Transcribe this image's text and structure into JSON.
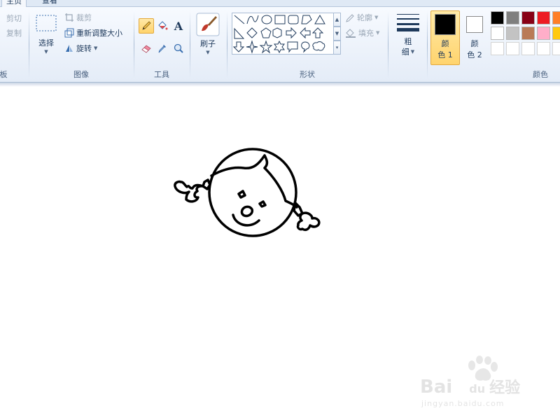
{
  "tabs": [
    {
      "label": "主页"
    },
    {
      "label": "查看"
    }
  ],
  "clipboard": {
    "cut_label": "剪切",
    "copy_label": "复制",
    "group_label": "板"
  },
  "image": {
    "select_label": "选择",
    "crop_label": "裁剪",
    "resize_label": "重新调整大小",
    "rotate_label": "旋转",
    "group_label": "图像"
  },
  "tools": {
    "group_label": "工具",
    "text_glyph": "A"
  },
  "brushes": {
    "label": "刷子"
  },
  "shapes": {
    "outline_label": "轮廓",
    "fill_label": "填充",
    "group_label": "形状"
  },
  "size": {
    "label_line1": "粗",
    "label_line2": "细"
  },
  "colors": {
    "color1_line1": "颜",
    "color1_line2": "色 1",
    "color2_line1": "颜",
    "color2_line2": "色 2",
    "color1_value": "#000000",
    "color2_value": "#ffffff",
    "group_label": "颜色",
    "palette_row1": [
      "#000000",
      "#7f7f7f",
      "#880015",
      "#ed1c24",
      "#ff7f27"
    ],
    "palette_row2": [
      "#ffffff",
      "#c3c3c3",
      "#b97a57",
      "#ffaec9",
      "#ffc90e"
    ],
    "palette_row3": [
      "#ffffff",
      "#ffffff",
      "#ffffff",
      "#ffffff",
      "#ffffff"
    ]
  },
  "watermark": {
    "brand": "Bai",
    "brand_suffix": "du",
    "product": "经验",
    "url": "jingyan.baidu.com"
  }
}
